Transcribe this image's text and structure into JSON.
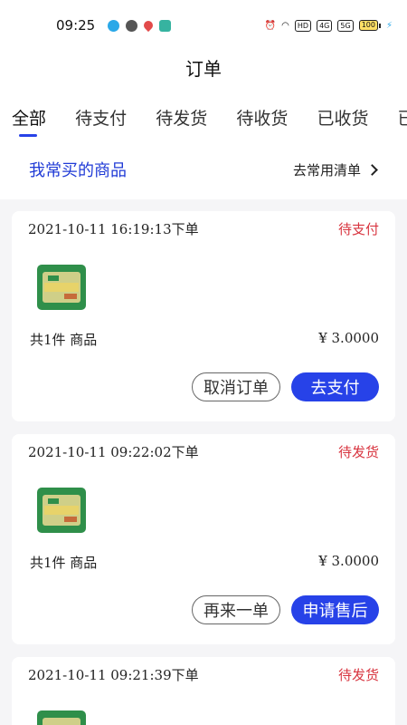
{
  "statusbar": {
    "time": "09:25",
    "chips": [
      "HD",
      "4G",
      "5G"
    ],
    "battery": "100"
  },
  "nav": {
    "title": "订单"
  },
  "tabs": [
    "全部",
    "待支付",
    "待发货",
    "待收货",
    "已收货",
    "已"
  ],
  "favorites": {
    "title": "我常买的商品",
    "link": "去常用清单"
  },
  "orders": [
    {
      "time": "2021-10-11 16:19:13下单",
      "status": "待支付",
      "count": "共1件 商品",
      "price": "¥ 3.0000",
      "btn1": "取消订单",
      "btn2": "去支付"
    },
    {
      "time": "2021-10-11 09:22:02下单",
      "status": "待发货",
      "count": "共1件 商品",
      "price": "¥ 3.0000",
      "btn1": "再来一单",
      "btn2": "申请售后"
    },
    {
      "time": "2021-10-11 09:21:39下单",
      "status": "待发货"
    }
  ],
  "colors": {
    "accent": "#2742e8",
    "status": "#d8343f",
    "favorite": "#1f3ad6"
  }
}
